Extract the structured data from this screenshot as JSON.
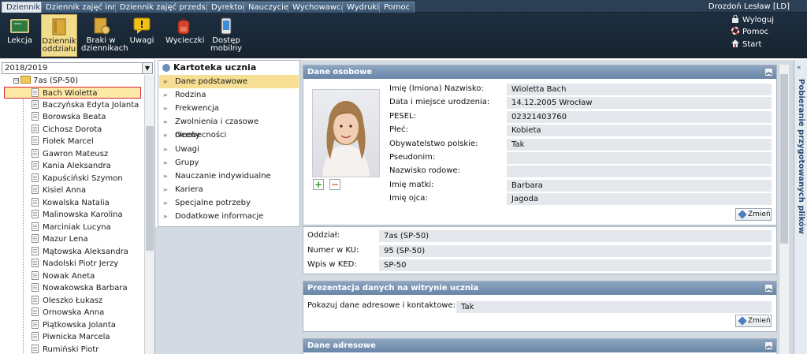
{
  "menu": {
    "tabs": [
      "Dziennik",
      "Dziennik zajęć innych",
      "Dziennik zajęć przedszkola",
      "Dyrektor",
      "Nauczyciel",
      "Wychowawca",
      "Wydruki",
      "Pomoc"
    ],
    "user": "Drozdoń Lesław [LD]"
  },
  "toolbar": {
    "buttons": [
      "Lekcja",
      "Dziennik oddziału",
      "Braki w dziennikach",
      "Uwagi",
      "Wycieczki",
      "Dostęp mobilny"
    ],
    "links": [
      "Wyloguj",
      "Pomoc",
      "Start"
    ]
  },
  "left": {
    "year": "2018/2019",
    "class_node": "7as (SP-50)",
    "students": [
      "Bach Wioletta",
      "Baczyńska Edyta Jolanta",
      "Borowska Beata",
      "Cichosz Dorota",
      "Fiołek Marcel",
      "Gawron Mateusz",
      "Kania Aleksandra",
      "Kapuściński Szymon",
      "Kisiel Anna",
      "Kowalska Natalia",
      "Malinowska Karolina",
      "Marciniak Lucyna",
      "Mazur Lena",
      "Mątowska Aleksandra",
      "Nadolski Piotr Jerzy",
      "Nowak Aneta",
      "Nowakowska Barbara",
      "Oleszko Łukasz",
      "Ornowska Anna",
      "Piątkowska Jolanta",
      "Piwnicka Marcela",
      "Rumiński Piotr"
    ]
  },
  "mid": {
    "title": "Kartoteka ucznia",
    "items": [
      "Dane podstawowe",
      "Rodzina",
      "Frekwencja",
      "Zwolnienia i czasowe nieobecności",
      "Oceny",
      "Uwagi",
      "Grupy",
      "Nauczanie indywidualne",
      "Kariera",
      "Specjalne potrzeby",
      "Dodatkowe informacje"
    ]
  },
  "dane_osobowe": {
    "title": "Dane osobowe",
    "fields": [
      {
        "label": "Imię (Imiona) Nazwisko:",
        "value": "Wioletta Bach"
      },
      {
        "label": "Data i miejsce urodzenia:",
        "value": "14.12.2005 Wrocław"
      },
      {
        "label": "PESEL:",
        "value": "02321403760"
      },
      {
        "label": "Płeć:",
        "value": "Kobieta"
      },
      {
        "label": "Obywatelstwo polskie:",
        "value": "Tak"
      },
      {
        "label": "Pseudonim:",
        "value": ""
      },
      {
        "label": "Nazwisko rodowe:",
        "value": ""
      },
      {
        "label": "Imię matki:",
        "value": "Barbara"
      },
      {
        "label": "Imię ojca:",
        "value": "Jagoda"
      }
    ],
    "button": "Zmień"
  },
  "class_info": {
    "fields": [
      {
        "label": "Oddział:",
        "value": "7as (SP-50)"
      },
      {
        "label": "Numer w KU:",
        "value": "95 (SP-50)"
      },
      {
        "label": "Wpis w KED:",
        "value": "SP-50"
      }
    ]
  },
  "prezentacja": {
    "title": "Prezentacja danych na witrynie ucznia",
    "label": "Pokazuj dane adresowe i kontaktowe:",
    "value": "Tak",
    "button": "Zmień"
  },
  "adresowe": {
    "title": "Dane adresowe"
  },
  "side_panel": {
    "label": "Pobieranie przygotowanych plików"
  },
  "colors": {
    "menubar": "#2b3f55",
    "toolbar": "#1d2e40",
    "active": "#f6df92",
    "panel_header": "#7894b3",
    "selection_border": "#d9263a"
  }
}
